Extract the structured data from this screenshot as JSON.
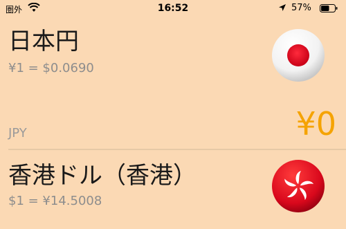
{
  "status_bar": {
    "carrier": "圏外",
    "time": "16:52",
    "battery_percent": "57%"
  },
  "currencies": [
    {
      "name": "日本円",
      "rate": "¥1 = $0.0690",
      "code": "JPY",
      "amount": "¥0",
      "flag_icon": "japan-flag-icon"
    },
    {
      "name": "香港ドル（香港）",
      "rate": "$1 = ¥14.5008",
      "flag_icon": "hong-kong-flag-icon"
    }
  ],
  "colors": {
    "background": "#fbd9b4",
    "accent": "#f5a300",
    "japan_red": "#e6001c",
    "hk_red": "#d9081c"
  }
}
